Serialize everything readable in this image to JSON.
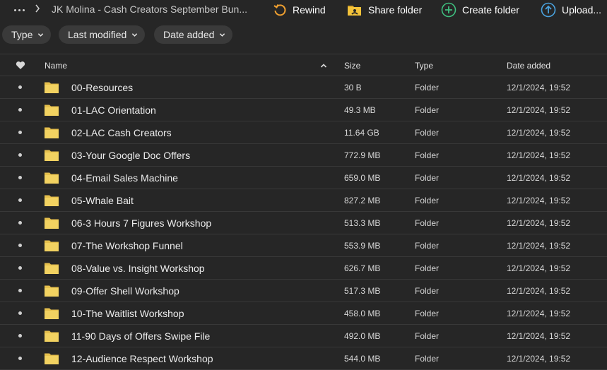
{
  "topbar": {
    "breadcrumb": "JK Molina - Cash Creators September Bun...",
    "actions": {
      "rewind": "Rewind",
      "share_folder": "Share folder",
      "create_folder": "Create folder",
      "upload": "Upload..."
    }
  },
  "filters": {
    "type": "Type",
    "last_modified": "Last modified",
    "date_added": "Date added"
  },
  "table": {
    "headers": {
      "name": "Name",
      "size": "Size",
      "type": "Type",
      "date_added": "Date added"
    },
    "rows": [
      {
        "name": "00-Resources",
        "size": "30 B",
        "type": "Folder",
        "date": "12/1/2024, 19:52"
      },
      {
        "name": "01-LAC Orientation",
        "size": "49.3 MB",
        "type": "Folder",
        "date": "12/1/2024, 19:52"
      },
      {
        "name": "02-LAC Cash Creators",
        "size": "11.64 GB",
        "type": "Folder",
        "date": "12/1/2024, 19:52"
      },
      {
        "name": "03-Your Google Doc Offers",
        "size": "772.9 MB",
        "type": "Folder",
        "date": "12/1/2024, 19:52"
      },
      {
        "name": "04-Email Sales Machine",
        "size": "659.0 MB",
        "type": "Folder",
        "date": "12/1/2024, 19:52"
      },
      {
        "name": "05-Whale Bait",
        "size": "827.2 MB",
        "type": "Folder",
        "date": "12/1/2024, 19:52"
      },
      {
        "name": "06-3 Hours 7 Figures Workshop",
        "size": "513.3 MB",
        "type": "Folder",
        "date": "12/1/2024, 19:52"
      },
      {
        "name": "07-The Workshop Funnel",
        "size": "553.9 MB",
        "type": "Folder",
        "date": "12/1/2024, 19:52"
      },
      {
        "name": "08-Value vs. Insight Workshop",
        "size": "626.7 MB",
        "type": "Folder",
        "date": "12/1/2024, 19:52"
      },
      {
        "name": "09-Offer Shell Workshop",
        "size": "517.3 MB",
        "type": "Folder",
        "date": "12/1/2024, 19:52"
      },
      {
        "name": "10-The Waitlist Workshop",
        "size": "458.0 MB",
        "type": "Folder",
        "date": "12/1/2024, 19:52"
      },
      {
        "name": "11-90 Days of Offers Swipe File",
        "size": "492.0 MB",
        "type": "Folder",
        "date": "12/1/2024, 19:52"
      },
      {
        "name": "12-Audience Respect Workshop",
        "size": "544.0 MB",
        "type": "Folder",
        "date": "12/1/2024, 19:52"
      }
    ]
  },
  "colors": {
    "background": "#262626",
    "folder": "#f2d261",
    "accent_green": "#3fbf7f",
    "accent_blue": "#4aa3df",
    "accent_orange": "#f0a030"
  },
  "icons": {
    "more": "more-horizontal-icon",
    "chevron": "chevron-right-icon",
    "rewind": "rewind-icon",
    "share": "share-folder-icon",
    "create": "create-folder-icon",
    "upload": "upload-icon",
    "favorite": "heart-icon",
    "sort": "sort-ascending-icon",
    "folder": "folder-icon"
  }
}
